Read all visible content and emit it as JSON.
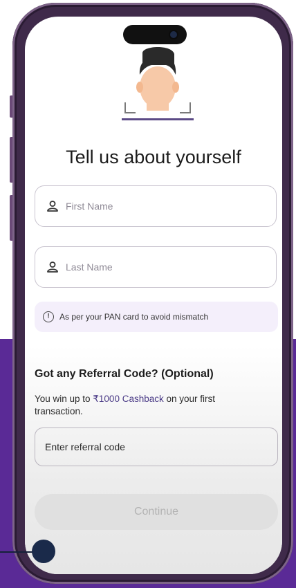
{
  "screen": {
    "title": "Tell us about yourself",
    "fields": {
      "first_name_placeholder": "First Name",
      "last_name_placeholder": "Last Name"
    },
    "note": "As per your PAN card to avoid mismatch",
    "referral": {
      "heading": "Got any Referral Code? (Optional)",
      "desc_prefix": "You win up to ",
      "cashback": "₹1000 Cashback",
      "desc_suffix": " on your first transaction.",
      "input_placeholder": "Enter referral code"
    },
    "continue_label": "Continue"
  },
  "icons": {
    "avatar": "person-avatar-icon",
    "user": "user-icon",
    "info": "info-icon"
  },
  "colors": {
    "background_purple": "#5a2a96",
    "accent": "#4a3a86",
    "button_disabled": "#e0e0e0"
  }
}
